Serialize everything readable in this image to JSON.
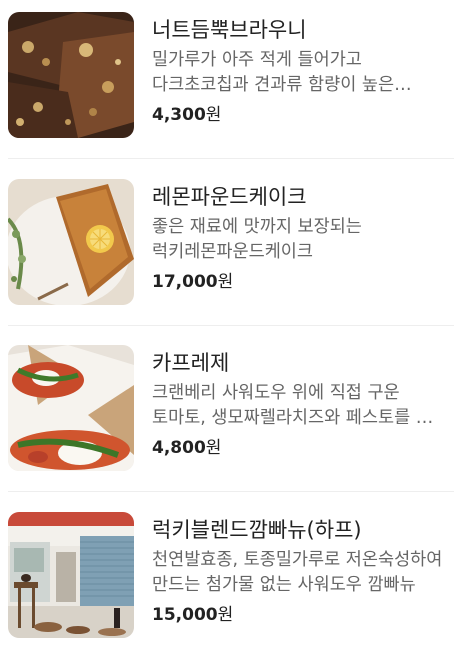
{
  "products": [
    {
      "name": "너트듬뿍브라우니",
      "description": "밀가루가 아주 적게 들어가고 다크초코칩과 견과류 함량이 높은 너트듬뿍브라우니",
      "price": "4,300",
      "currency": "원",
      "image": "brownie-photo"
    },
    {
      "name": "레몬파운드케이크",
      "description": "좋은 재료에 맛까지 보장되는 럭키레몬파운드케이크",
      "price": "17,000",
      "currency": "원",
      "image": "lemon-pound-cake-photo"
    },
    {
      "name": "카프레제",
      "description": "크랜베리 사워도우 위에 직접 구운 토마토, 생모짜렐라치즈와 페스토를 올린 카프레제",
      "price": "4,800",
      "currency": "원",
      "image": "caprese-photo"
    },
    {
      "name": "럭키블렌드깜빠뉴(하프)",
      "description": "천연발효종, 토종밀가루로 저온숙성하여 만드는 첨가물 없는 사워도우 깜빠뉴",
      "price": "15,000",
      "currency": "원",
      "image": "storefront-photo"
    }
  ]
}
